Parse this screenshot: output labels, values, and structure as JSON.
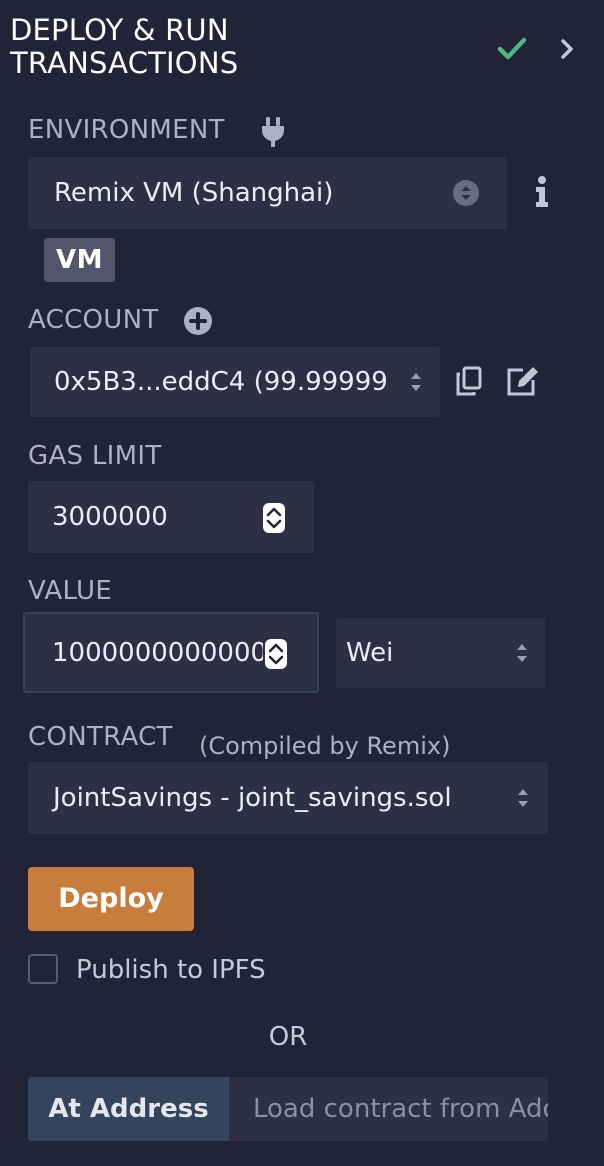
{
  "header": {
    "title_line1": "DEPLOY & RUN",
    "title_line2": "TRANSACTIONS",
    "status_icon": "check-icon",
    "expand_icon": "chevron-right-icon",
    "status_color": "#4bb881"
  },
  "environment": {
    "label": "ENVIRONMENT",
    "selected": "Remix VM (Shanghai)",
    "badge": "VM",
    "icon": "plug-icon",
    "info_icon": "info-icon"
  },
  "account": {
    "label": "ACCOUNT",
    "selected": "0x5B3...eddC4 (99.99999",
    "add_icon": "plus-circle-icon",
    "copy_icon": "copy-icon",
    "edit_icon": "edit-icon"
  },
  "gas_limit": {
    "label": "GAS LIMIT",
    "value": "3000000"
  },
  "value": {
    "label": "VALUE",
    "amount": "1000000000000",
    "unit": "Wei"
  },
  "contract": {
    "label": "CONTRACT",
    "note": "(Compiled by Remix)",
    "selected": "JointSavings - joint_savings.sol"
  },
  "deploy": {
    "label": "Deploy",
    "color": "#c97d3c"
  },
  "publish": {
    "label": "Publish to IPFS",
    "checked": false
  },
  "or_text": "OR",
  "at_address": {
    "label": "At Address",
    "placeholder": "Load contract from Address"
  }
}
